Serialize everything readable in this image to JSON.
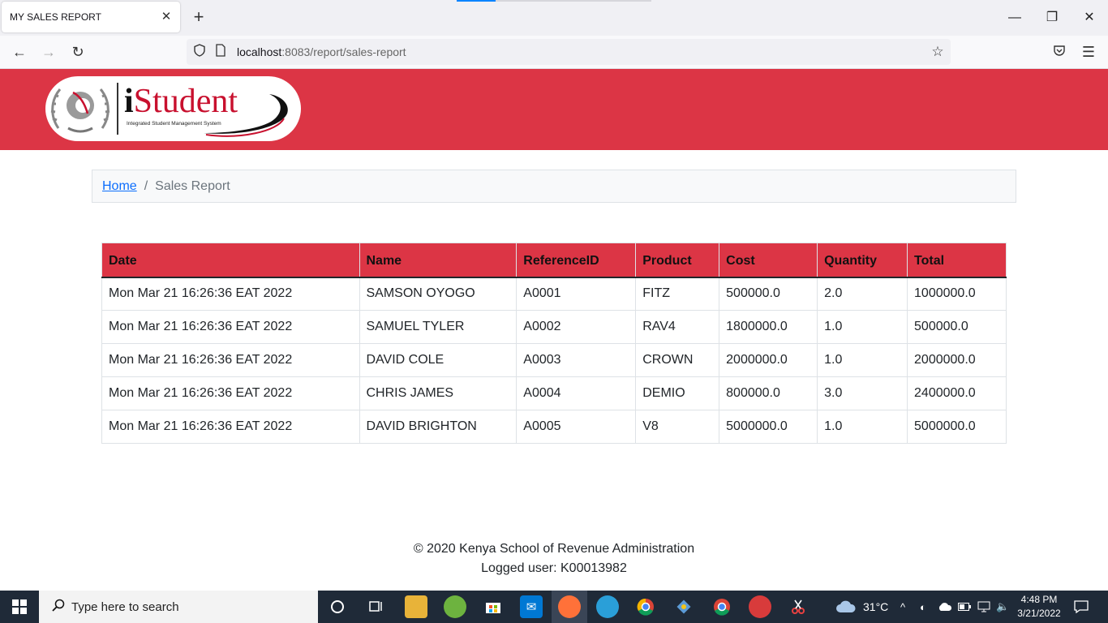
{
  "browser": {
    "tab_title": "MY SALES REPORT",
    "url_host": "localhost",
    "url_path": ":8083/report/sales-report"
  },
  "logo": {
    "name_first": "i",
    "name_rest": "Student",
    "tagline": "Integrated Student Management System"
  },
  "breadcrumb": {
    "home": "Home",
    "separator": "/",
    "current": "Sales Report"
  },
  "table": {
    "headers": [
      "Date",
      "Name",
      "ReferenceID",
      "Product",
      "Cost",
      "Quantity",
      "Total"
    ],
    "rows": [
      [
        "Mon Mar 21 16:26:36 EAT 2022",
        "SAMSON OYOGO",
        "A0001",
        "FITZ",
        "500000.0",
        "2.0",
        "1000000.0"
      ],
      [
        "Mon Mar 21 16:26:36 EAT 2022",
        "SAMUEL TYLER",
        "A0002",
        "RAV4",
        "1800000.0",
        "1.0",
        "500000.0"
      ],
      [
        "Mon Mar 21 16:26:36 EAT 2022",
        "DAVID COLE",
        "A0003",
        "CROWN",
        "2000000.0",
        "1.0",
        "2000000.0"
      ],
      [
        "Mon Mar 21 16:26:36 EAT 2022",
        "CHRIS JAMES",
        "A0004",
        "DEMIO",
        "800000.0",
        "3.0",
        "2400000.0"
      ],
      [
        "Mon Mar 21 16:26:36 EAT 2022",
        "DAVID BRIGHTON",
        "A0005",
        "V8",
        "5000000.0",
        "1.0",
        "5000000.0"
      ]
    ]
  },
  "footer": {
    "copyright": "© 2020 Kenya School of Revenue Administration",
    "logged_user": "Logged user: K00013982"
  },
  "taskbar": {
    "search_placeholder": "Type here to search",
    "weather": "31°C",
    "time": "4:48 PM",
    "date": "3/21/2022"
  },
  "colors": {
    "brand": "#dc3545",
    "link": "#0d6efd",
    "taskbar": "#1f2a38"
  }
}
